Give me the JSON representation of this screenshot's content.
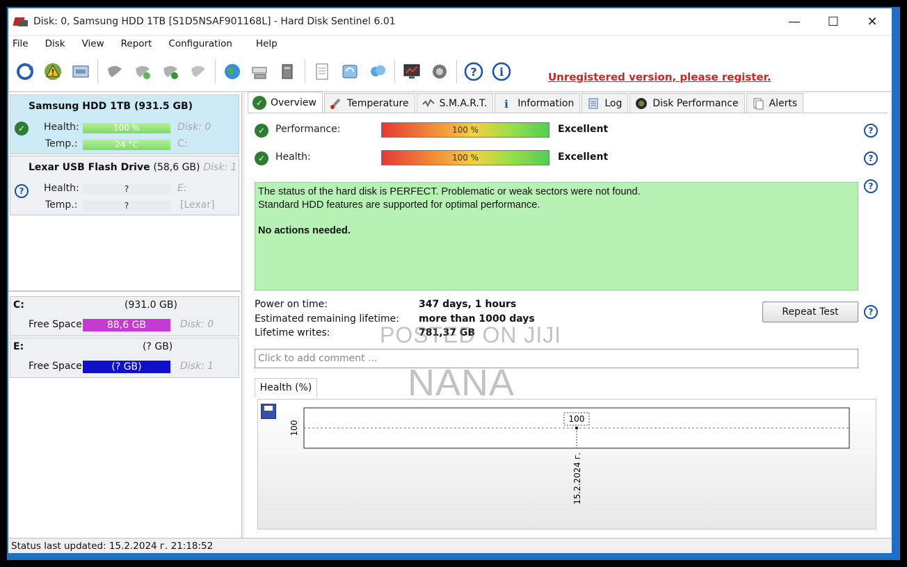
{
  "window": {
    "title": "Disk: 0, Samsung HDD 1TB [S1D5NSAF901168L]  -  Hard Disk Sentinel 6.01",
    "minimize": "—",
    "maximize": "☐",
    "close": "✕"
  },
  "menu": [
    "File",
    "Disk",
    "View",
    "Report",
    "Configuration",
    "Help"
  ],
  "toolbar": {
    "register_link": "Unregistered version, please register."
  },
  "disks": [
    {
      "title": "Samsung HDD 1TB (931.5 GB)",
      "health_label": "Health:",
      "health_value": "100 %",
      "health_fraction": 1.0,
      "temp_label": "Temp.:",
      "temp_value": "24 °C",
      "side1": "Disk: 0",
      "side2": "C:"
    },
    {
      "title": "Lexar   USB Flash Drive",
      "title_size": "(58,6 GB)",
      "title_disk": "Disk: 1",
      "health_label": "Health:",
      "health_value": "?",
      "temp_label": "Temp.:",
      "temp_value": "?",
      "side1": "E:",
      "side2": "[Lexar]"
    }
  ],
  "volumes": [
    {
      "letter": "C:",
      "size": "(931.0 GB)",
      "free_label": "Free Space",
      "free_value": "88,6 GB",
      "disk": "Disk: 0",
      "bar_color": "#c53ad0"
    },
    {
      "letter": "E:",
      "size": "(? GB)",
      "free_label": "Free Space",
      "free_value": "(? GB)",
      "disk": "Disk: 1",
      "bar_color": "#1010c8"
    }
  ],
  "tabs": [
    "Overview",
    "Temperature",
    "S.M.A.R.T.",
    "Information",
    "Log",
    "Disk Performance",
    "Alerts"
  ],
  "overview": {
    "performance_label": "Performance:",
    "performance_value": "100 %",
    "performance_text": "Excellent",
    "health_label": "Health:",
    "health_value": "100 %",
    "health_text": "Excellent",
    "status_line1": "The status of the hard disk is PERFECT. Problematic or weak sectors were not found.",
    "status_line2": "Standard HDD features are supported for optimal performance.",
    "status_line3": "No actions needed.",
    "power_on_label": "Power on time:",
    "power_on_value": "347 days, 1 hours",
    "remaining_label": "Estimated remaining lifetime:",
    "remaining_value": "more than 1000 days",
    "writes_label": "Lifetime writes:",
    "writes_value": "781,37 GB",
    "repeat_test": "Repeat Test",
    "comment_placeholder": "Click to add comment ..."
  },
  "health_tab": "Health (%)",
  "chart_data": {
    "type": "line",
    "x": [
      "15.2.2024 г."
    ],
    "values": [
      100
    ],
    "ylabel": "100",
    "point_label": "100"
  },
  "status_bar": "Status last updated: 15.2.2024 г. 21:18:52",
  "watermarks": {
    "line1": "POSTED ON JIJI",
    "line2": "NANA"
  }
}
